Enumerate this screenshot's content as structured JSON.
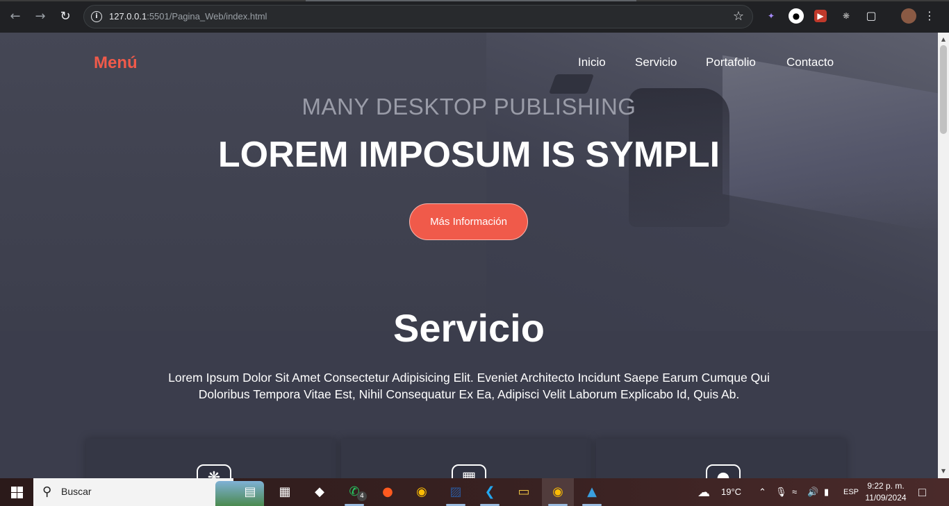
{
  "browser": {
    "url_host": "127.0.0.1",
    "url_path": ":5501/Pagina_Web/index.html"
  },
  "page": {
    "logo": "Menú",
    "nav": [
      "Inicio",
      "Servicio",
      "Portafolio",
      "Contacto"
    ],
    "hero": {
      "kicker": "MANY DESKTOP PUBLISHING",
      "headline": "LOREM IMPOSUM IS SYMPLI",
      "cta": "Más Información"
    },
    "services": {
      "title": "Servicio",
      "description": "Lorem Ipsum Dolor Sit Amet Consectetur Adipisicing Elit. Eveniet Architecto Incidunt Saepe Earum Cumque Qui Doloribus Tempora Vitae Est, Nihil Consequatur Ex Ea, Adipisci Velit Laborum Explicabo Id, Quis Ab."
    },
    "accent_color": "#f05a4a"
  },
  "taskbar": {
    "search_placeholder": "Buscar",
    "whatsapp_badge": "4",
    "weather": "19°C",
    "language": "ESP",
    "time": "9:22 p. m.",
    "date": "11/09/2024"
  }
}
